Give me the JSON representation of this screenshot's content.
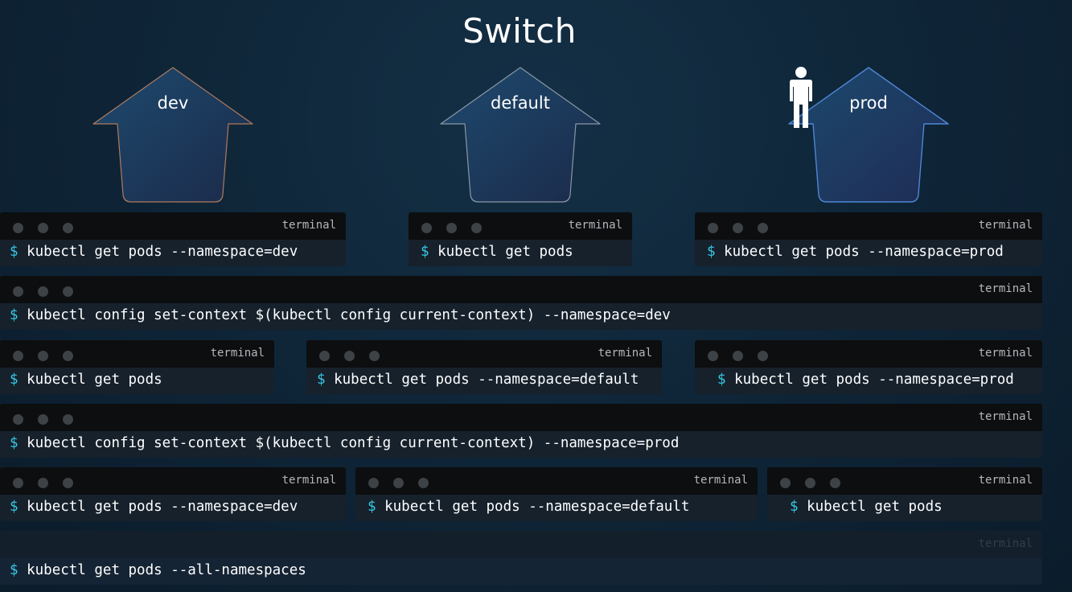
{
  "title": "Switch",
  "namespaces": [
    {
      "label": "dev",
      "border_color": "#b07a5e"
    },
    {
      "label": "default",
      "border_color": "#8a97a6"
    },
    {
      "label": "prod",
      "border_color": "#4f86d6",
      "icon": "person-icon"
    }
  ],
  "terminal_title": "terminal",
  "prompt": "$",
  "colors": {
    "prompt": "#35c8e6",
    "terminal_bar": "#0c0e10",
    "terminal_body": "#16212c"
  },
  "terminals": [
    {
      "cmd": "kubectl get pods --namespace=dev"
    },
    {
      "cmd": "kubectl get pods"
    },
    {
      "cmd": "kubectl get pods --namespace=prod"
    },
    {
      "cmd": "kubectl config set-context $(kubectl config current-context) --namespace=dev"
    },
    {
      "cmd": "kubectl get pods"
    },
    {
      "cmd": "kubectl get pods --namespace=default"
    },
    {
      "cmd": "kubectl get pods --namespace=prod"
    },
    {
      "cmd": "kubectl config set-context $(kubectl config current-context) --namespace=prod"
    },
    {
      "cmd": "kubectl get pods --namespace=dev"
    },
    {
      "cmd": "kubectl get pods --namespace=default"
    },
    {
      "cmd": "kubectl get pods"
    },
    {
      "cmd": "kubectl get pods --all-namespaces"
    }
  ]
}
